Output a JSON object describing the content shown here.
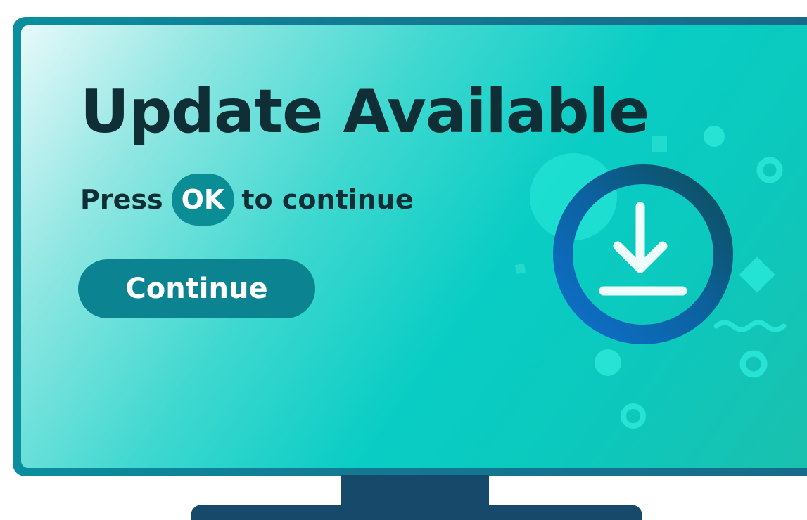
{
  "screen": {
    "title": "Update Available",
    "subtitle_before": "Press",
    "ok_key_label": "OK",
    "subtitle_after": "to continue",
    "continue_label": "Continue"
  },
  "icons": {
    "main": "download-icon"
  },
  "colors": {
    "title_text": "#0f2e35",
    "button_bg": "#0b8390",
    "button_text": "#ffffff",
    "tv_frame": "#137a93",
    "tv_stand": "#17496a",
    "ring_gradient_start": "#0b5a63",
    "ring_gradient_end": "#0d6cc4"
  }
}
